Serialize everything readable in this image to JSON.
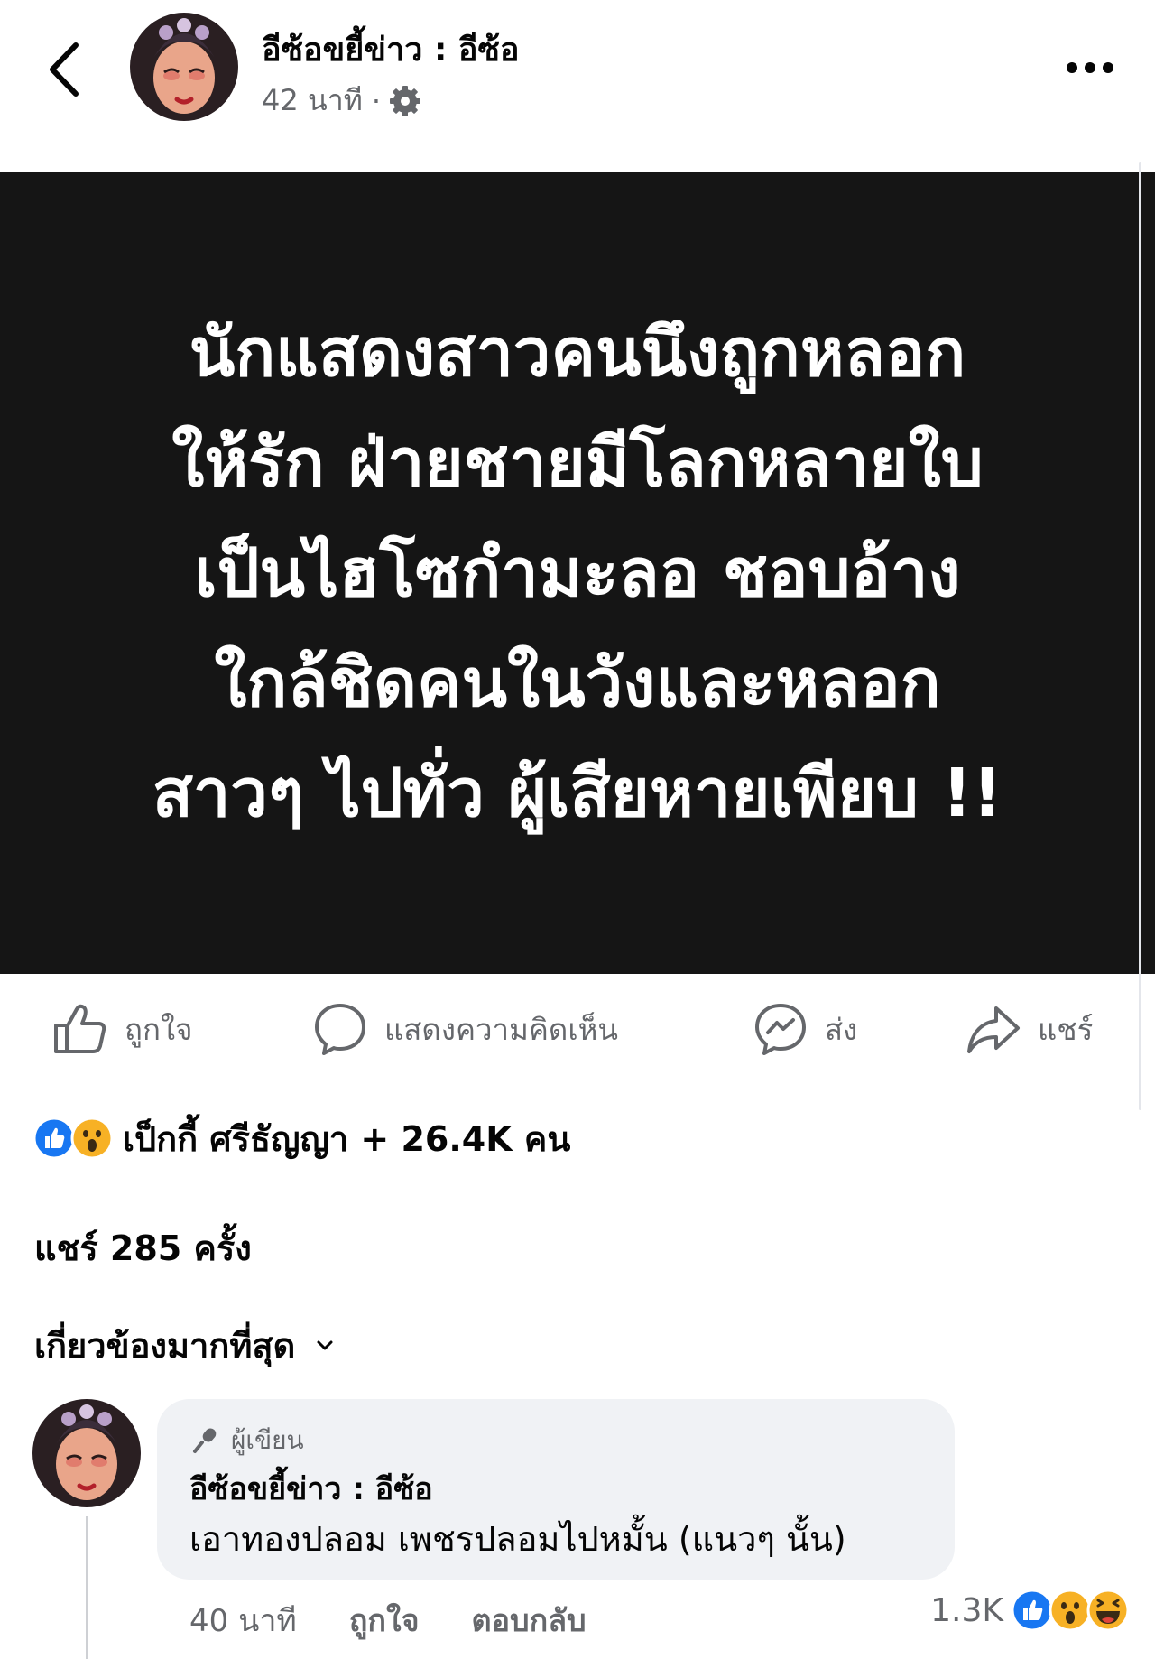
{
  "header": {
    "page_name": "อีซ้อขยี้ข่าว : อีซ้อ",
    "time": "42 นาที",
    "dot": "·"
  },
  "post_image": {
    "lines": [
      "นักแสดงสาวคนนึงถูกหลอก",
      "ให้รัก ฝ่ายชายมีโลกหลายใบ",
      "เป็นไฮโซกำมะลอ ชอบอ้าง",
      "ใกล้ชิดคนในวังและหลอก",
      "สาวๆ ไปทั่ว ผู้เสียหายเพียบ !!"
    ],
    "background": "#151515"
  },
  "actions": {
    "like": "ถูกใจ",
    "comment": "แสดงความคิดเห็น",
    "send": "ส่ง",
    "share": "แชร์"
  },
  "reactions": {
    "summary": "เป็กกี้ ศรีธัญญา + 26.4K คน",
    "icons": [
      "like-icon",
      "wow-icon"
    ]
  },
  "shares": "แชร์ 285 ครั้ง",
  "sort": {
    "label": "เกี่ยวข้องมากที่สุด"
  },
  "comment": {
    "badge": "ผู้เขียน",
    "author": "อีซ้อขยี้ข่าว : อีซ้อ",
    "text": "เอาทองปลอม เพชรปลอมไปหมั้น (แนวๆ นั้น)",
    "time": "40 นาที",
    "like": "ถูกใจ",
    "reply": "ตอบกลับ",
    "reaction_count": "1.3K",
    "reaction_icons": [
      "like-icon",
      "wow-icon",
      "haha-icon"
    ]
  },
  "colors": {
    "accent": "#1877f2",
    "secondary_text": "#65676b",
    "bubble": "#f0f2f5"
  }
}
